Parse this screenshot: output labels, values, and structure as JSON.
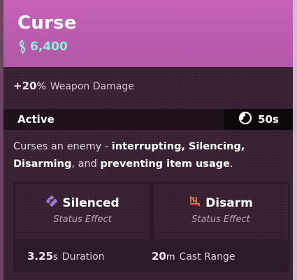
{
  "item": {
    "name": "Curse",
    "cost": "6,400"
  },
  "bonus": {
    "value": "+20",
    "unit": "%",
    "label": "Weapon Damage"
  },
  "ability": {
    "type_label": "Active",
    "cooldown": "50s",
    "description_parts": {
      "p1": "Curses an enemy - ",
      "b1": "interrupting, Silencing,",
      "b2": "Disarming",
      "p2": ", and ",
      "b3": "preventing item usage",
      "p3": "."
    }
  },
  "effects": [
    {
      "name": "Silenced",
      "subtitle": "Status Effect",
      "icon": "silenced-icon",
      "color": "#9a7bd6"
    },
    {
      "name": "Disarm",
      "subtitle": "Status Effect",
      "icon": "disarm-icon",
      "color": "#e0644a"
    }
  ],
  "stats": [
    {
      "value": "3.25",
      "unit": "s",
      "label": "Duration"
    },
    {
      "value": "20",
      "unit": "m",
      "label": "Cast Range"
    }
  ],
  "colors": {
    "header": "#c462b8",
    "cost": "#8ef0d6",
    "panel": "#3a2435"
  }
}
